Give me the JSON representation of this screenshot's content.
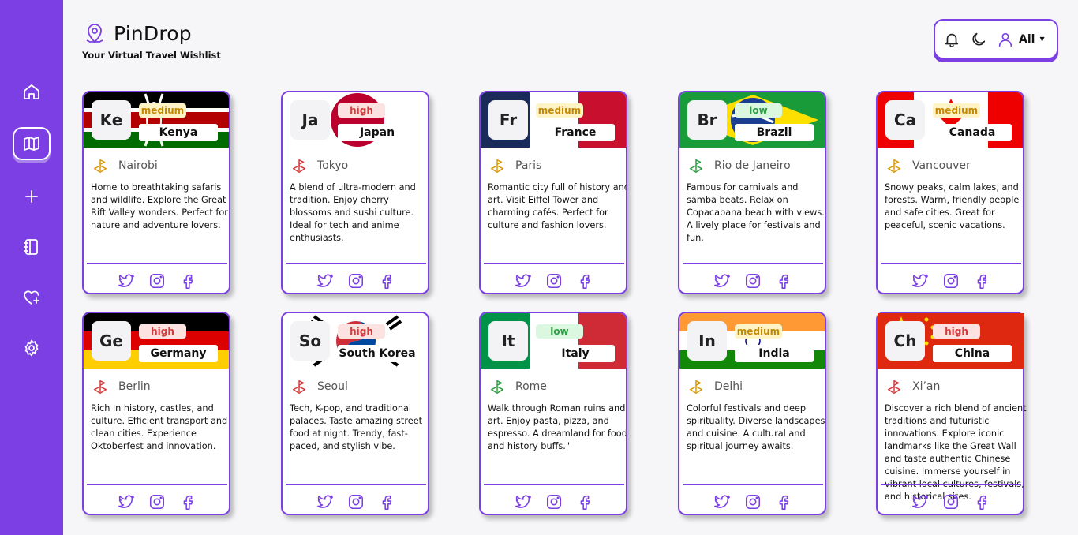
{
  "app": {
    "title": "PinDrop",
    "subtitle": "Your Virtual Travel Wishlist"
  },
  "sidebar": {
    "items": [
      {
        "name": "home",
        "icon": "home-icon"
      },
      {
        "name": "map",
        "icon": "map-icon",
        "active": true
      },
      {
        "name": "add",
        "icon": "plus-icon"
      },
      {
        "name": "notebook",
        "icon": "notebook-icon"
      },
      {
        "name": "favorites",
        "icon": "heart-plus-icon"
      },
      {
        "name": "settings",
        "icon": "gear-icon"
      }
    ]
  },
  "header": {
    "user_name": "Ali",
    "icons": [
      "bell-icon",
      "moon-icon",
      "user-icon",
      "caret-down-icon"
    ]
  },
  "colors": {
    "accent": "#7b3fe4",
    "high": "#d63a3a",
    "medium": "#d99a0b",
    "low": "#2e9d44"
  },
  "cards": [
    {
      "abbr": "Ke",
      "country": "Kenya",
      "priority": "medium",
      "city": "Nairobi",
      "description": "Home to breathtaking safaris and wildlife. Explore the Great Rift Valley wonders. Perfect for nature and adventure lovers."
    },
    {
      "abbr": "Ja",
      "country": "Japan",
      "priority": "high",
      "city": "Tokyo",
      "description": "A blend of ultra-modern and tradition. Enjoy cherry blossoms and sushi culture. Ideal for tech and anime enthusiasts."
    },
    {
      "abbr": "Fr",
      "country": "France",
      "priority": "medium",
      "city": "Paris",
      "description": "Romantic city full of history and art. Visit Eiffel Tower and charming cafés. Perfect for culture and fashion lovers."
    },
    {
      "abbr": "Br",
      "country": "Brazil",
      "priority": "low",
      "city": "Rio de Janeiro",
      "description": "Famous for carnivals and samba beats. Relax on Copacabana beach with views. A lively place for festivals and fun."
    },
    {
      "abbr": "Ca",
      "country": "Canada",
      "priority": "medium",
      "city": "Vancouver",
      "description": "Snowy peaks, calm lakes, and forests. Warm, friendly people and safe cities. Great for peaceful, scenic vacations."
    },
    {
      "abbr": "Ge",
      "country": "Germany",
      "priority": "high",
      "city": "Berlin",
      "description": "Rich in history, castles, and culture. Efficient transport and clean cities. Experience Oktoberfest and innovation."
    },
    {
      "abbr": "So",
      "country": "South Korea",
      "priority": "high",
      "city": "Seoul",
      "description": "Tech, K-pop, and traditional palaces. Taste amazing street food at night. Trendy, fast-paced, and stylish vibe."
    },
    {
      "abbr": "It",
      "country": "Italy",
      "priority": "low",
      "city": "Rome",
      "description": "Walk through Roman ruins and art. Enjoy pasta, pizza, and espresso. A dreamland for food and history buffs.\""
    },
    {
      "abbr": "In",
      "country": "India",
      "priority": "medium",
      "city": "Delhi",
      "description": "Colorful festivals and deep spirituality. Diverse landscapes and cuisine. A cultural and spiritual journey awaits."
    },
    {
      "abbr": "Ch",
      "country": "China",
      "priority": "high",
      "city": "Xi’an",
      "description": "Discover a rich blend of ancient traditions and futuristic innovations. Explore iconic landmarks like the Great Wall and taste authentic Chinese cuisine. Immerse yourself in vibrant local cultures, festivals, and historical sites."
    }
  ],
  "social_icons": [
    "twitter-icon",
    "instagram-icon",
    "facebook-icon"
  ]
}
